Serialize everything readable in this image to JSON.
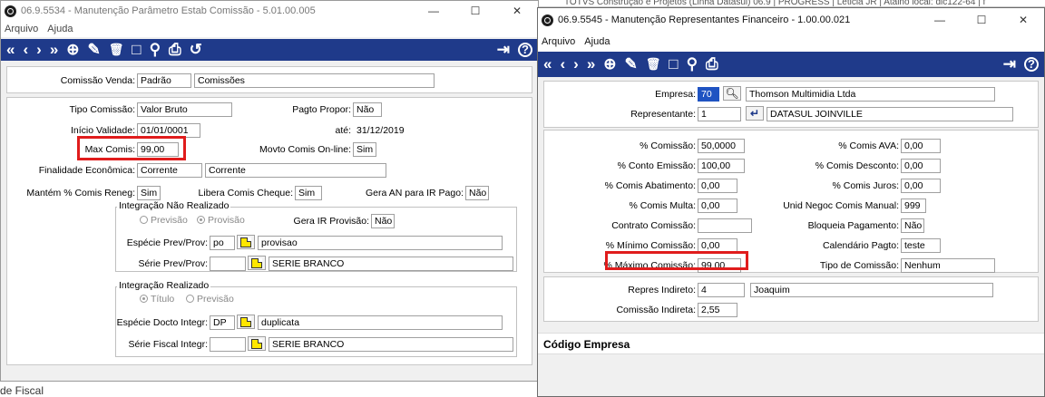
{
  "background_bar": {
    "text": "TOTVS Construção e Projetos (Linha Datasul) 06.9 | PROGRESS | Leticia JR | Ataino local: dic122-64 | f"
  },
  "bottom_left_text": "de Fiscal",
  "left_window": {
    "title": "06.9.5534 - Manutenção Parâmetro Estab Comissão - 5.01.00.005",
    "controls": {
      "minimize": "—",
      "maximize": "☐",
      "close": "✕"
    },
    "menu": {
      "file": "Arquivo",
      "help": "Ajuda"
    },
    "toolbar": {
      "first": "«",
      "prev": "‹",
      "next": "›",
      "last": "»",
      "add": "⊕",
      "edit": "✎",
      "delete": "🗑",
      "new": "□",
      "search": "⚲",
      "print": "⎙",
      "history": "↺",
      "exit": "⇥",
      "help": "?"
    },
    "fields": {
      "comissao_venda_label": "Comissão Venda:",
      "comissao_venda_value": "Padrão",
      "comissao_venda_desc": "Comissões",
      "tipo_comissao_label": "Tipo Comissão:",
      "tipo_comissao_value": "Valor Bruto",
      "pagto_propor_label": "Pagto Propor:",
      "pagto_propor_value": "Não",
      "inicio_validade_label": "Início Validade:",
      "inicio_validade_value": "01/01/0001",
      "ate_label": "até:",
      "ate_value": "31/12/2019",
      "max_comis_label": "Max Comis:",
      "max_comis_value": "99,00",
      "movto_label": "Movto Comis On-line:",
      "movto_value": "Sim",
      "finalidade_label": "Finalidade Econômica:",
      "finalidade_value": "Corrente",
      "finalidade_desc": "Corrente",
      "mantem_label": "Mantém % Comis Reneg:",
      "mantem_value": "Sim",
      "libera_label": "Libera Comis Cheque:",
      "libera_value": "Sim",
      "gera_an_label": "Gera AN para IR Pago:",
      "gera_an_value": "Não"
    },
    "nao_realizado": {
      "title": "Integração Não Realizado",
      "radio1": "Previsão",
      "radio2": "Provisão",
      "gera_ir_label": "Gera IR Provisão:",
      "gera_ir_value": "Não",
      "especie_label": "Espécie Prev/Prov:",
      "especie_value": "po",
      "especie_desc": "provisao",
      "serie_label": "Série Prev/Prov:",
      "serie_value": "",
      "serie_desc": "SERIE BRANCO"
    },
    "realizado": {
      "title": "Integração Realizado",
      "radio1": "Título",
      "radio2": "Previsão",
      "especie_label": "Espécie Docto Integr:",
      "especie_value": "DP",
      "especie_desc": "duplicata",
      "serie_label": "Série Fiscal Integr:",
      "serie_value": "",
      "serie_desc": "SERIE BRANCO"
    }
  },
  "right_window": {
    "title": "06.9.5545 - Manutenção Representantes Financeiro - 1.00.00.021",
    "controls": {
      "minimize": "—",
      "maximize": "☐",
      "close": "✕"
    },
    "menu": {
      "file": "Arquivo",
      "help": "Ajuda"
    },
    "toolbar": {
      "first": "«",
      "prev": "‹",
      "next": "›",
      "last": "»",
      "add": "⊕",
      "edit": "✎",
      "delete": "🗑",
      "new": "□",
      "search": "⚲",
      "print": "⎙",
      "exit": "⇥",
      "help": "?"
    },
    "header": {
      "empresa_label": "Empresa:",
      "empresa_value": "70",
      "empresa_desc": "Thomson Multimidia Ltda",
      "representante_label": "Representante:",
      "representante_value": "1",
      "representante_desc": "DATASUL JOINVILLE"
    },
    "fields": {
      "comissao_label": "% Comissão:",
      "comissao_value": "50,0000",
      "comis_ava_label": "% Comis AVA:",
      "comis_ava_value": "0,00",
      "conto_emissao_label": "% Conto Emissão:",
      "conto_emissao_value": "100,00",
      "comis_desconto_label": "% Comis Desconto:",
      "comis_desconto_value": "0,00",
      "comis_abatimento_label": "% Comis Abatimento:",
      "comis_abatimento_value": "0,00",
      "comis_juros_label": "% Comis Juros:",
      "comis_juros_value": "0,00",
      "comis_multa_label": "% Comis Multa:",
      "comis_multa_value": "0,00",
      "unid_negoc_label": "Unid Negoc Comis Manual:",
      "unid_negoc_value": "999",
      "contrato_label": "Contrato Comissão:",
      "contrato_value": "",
      "bloqueia_label": "Bloqueia Pagamento:",
      "bloqueia_value": "Não",
      "minimo_label": "% Mínimo Comissão:",
      "minimo_value": "0,00",
      "calendario_label": "Calendário Pagto:",
      "calendario_value": "teste",
      "maximo_label": "% Máximo Comissão:",
      "maximo_value": "99,00",
      "tipo_label": "Tipo de Comissão:",
      "tipo_value": "Nenhum"
    },
    "indireto": {
      "repres_label": "Repres Indireto:",
      "repres_value": "4",
      "repres_desc": "Joaquim",
      "comissao_label": "Comissão Indireta:",
      "comissao_value": "2,55"
    },
    "status": "Código Empresa"
  },
  "colors": {
    "toolbar": "#1f3a8a",
    "highlight": "#e01c1c",
    "selected": "#1f53c2"
  }
}
